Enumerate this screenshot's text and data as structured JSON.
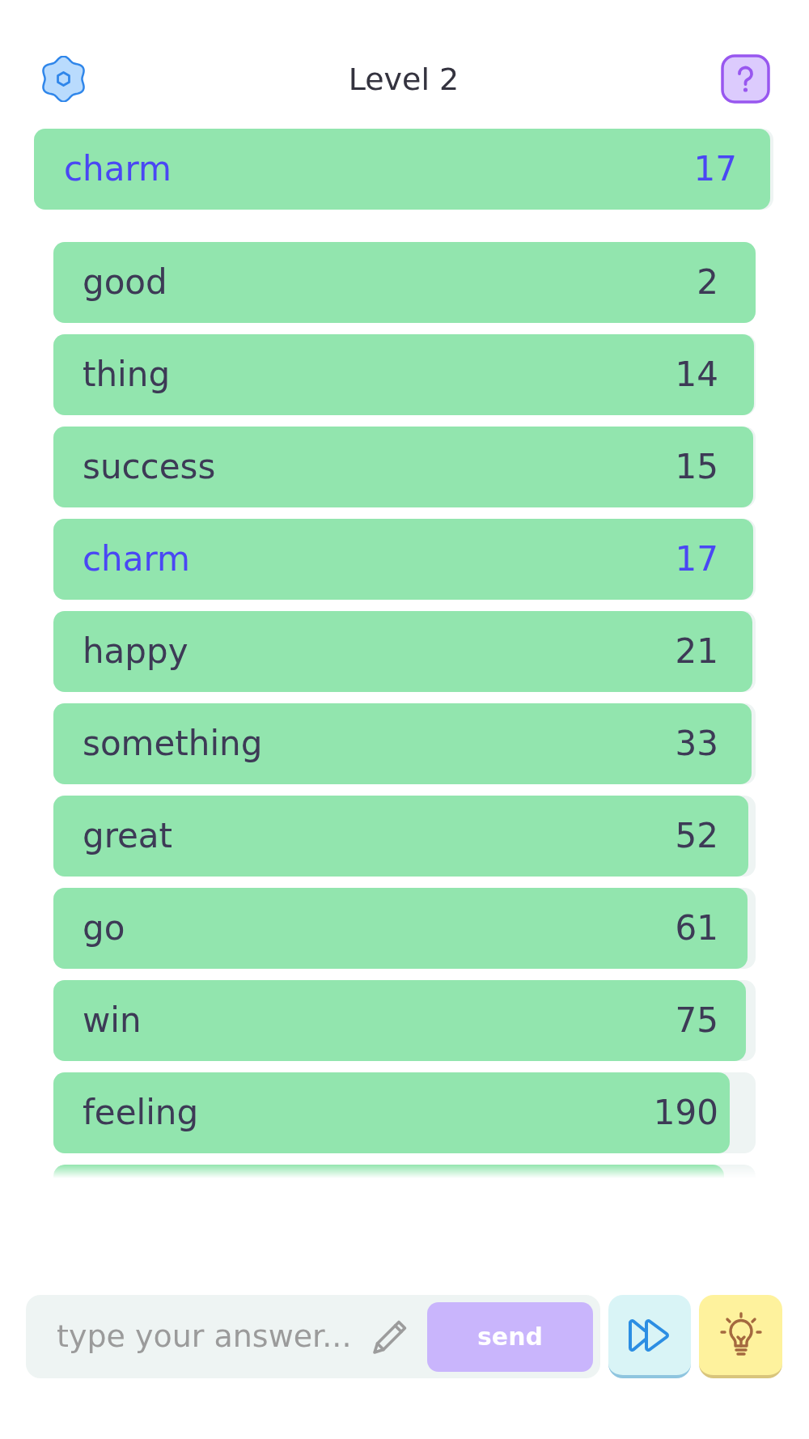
{
  "header": {
    "title": "Level 2"
  },
  "current_guess": {
    "word": "charm",
    "rank": "17",
    "level": 0.996
  },
  "guesses": [
    {
      "word": "good",
      "rank": "2",
      "level": 1,
      "highlighted": false
    },
    {
      "word": "thing",
      "rank": "14",
      "level": 0.998,
      "highlighted": false
    },
    {
      "word": "success",
      "rank": "15",
      "level": 0.997,
      "highlighted": false
    },
    {
      "word": "charm",
      "rank": "17",
      "level": 0.996,
      "highlighted": true
    },
    {
      "word": "happy",
      "rank": "21",
      "level": 0.995,
      "highlighted": false
    },
    {
      "word": "something",
      "rank": "33",
      "level": 0.994,
      "highlighted": false
    },
    {
      "word": "great",
      "rank": "52",
      "level": 0.99,
      "highlighted": false
    },
    {
      "word": "go",
      "rank": "61",
      "level": 0.989,
      "highlighted": false
    },
    {
      "word": "win",
      "rank": "75",
      "level": 0.986,
      "highlighted": false
    },
    {
      "word": "feeling",
      "rank": "190",
      "level": 0.963,
      "highlighted": false
    },
    {
      "level": 0.955
    }
  ],
  "answer_bar": {
    "placeholder": "type your answer...",
    "send_label": "send"
  }
}
